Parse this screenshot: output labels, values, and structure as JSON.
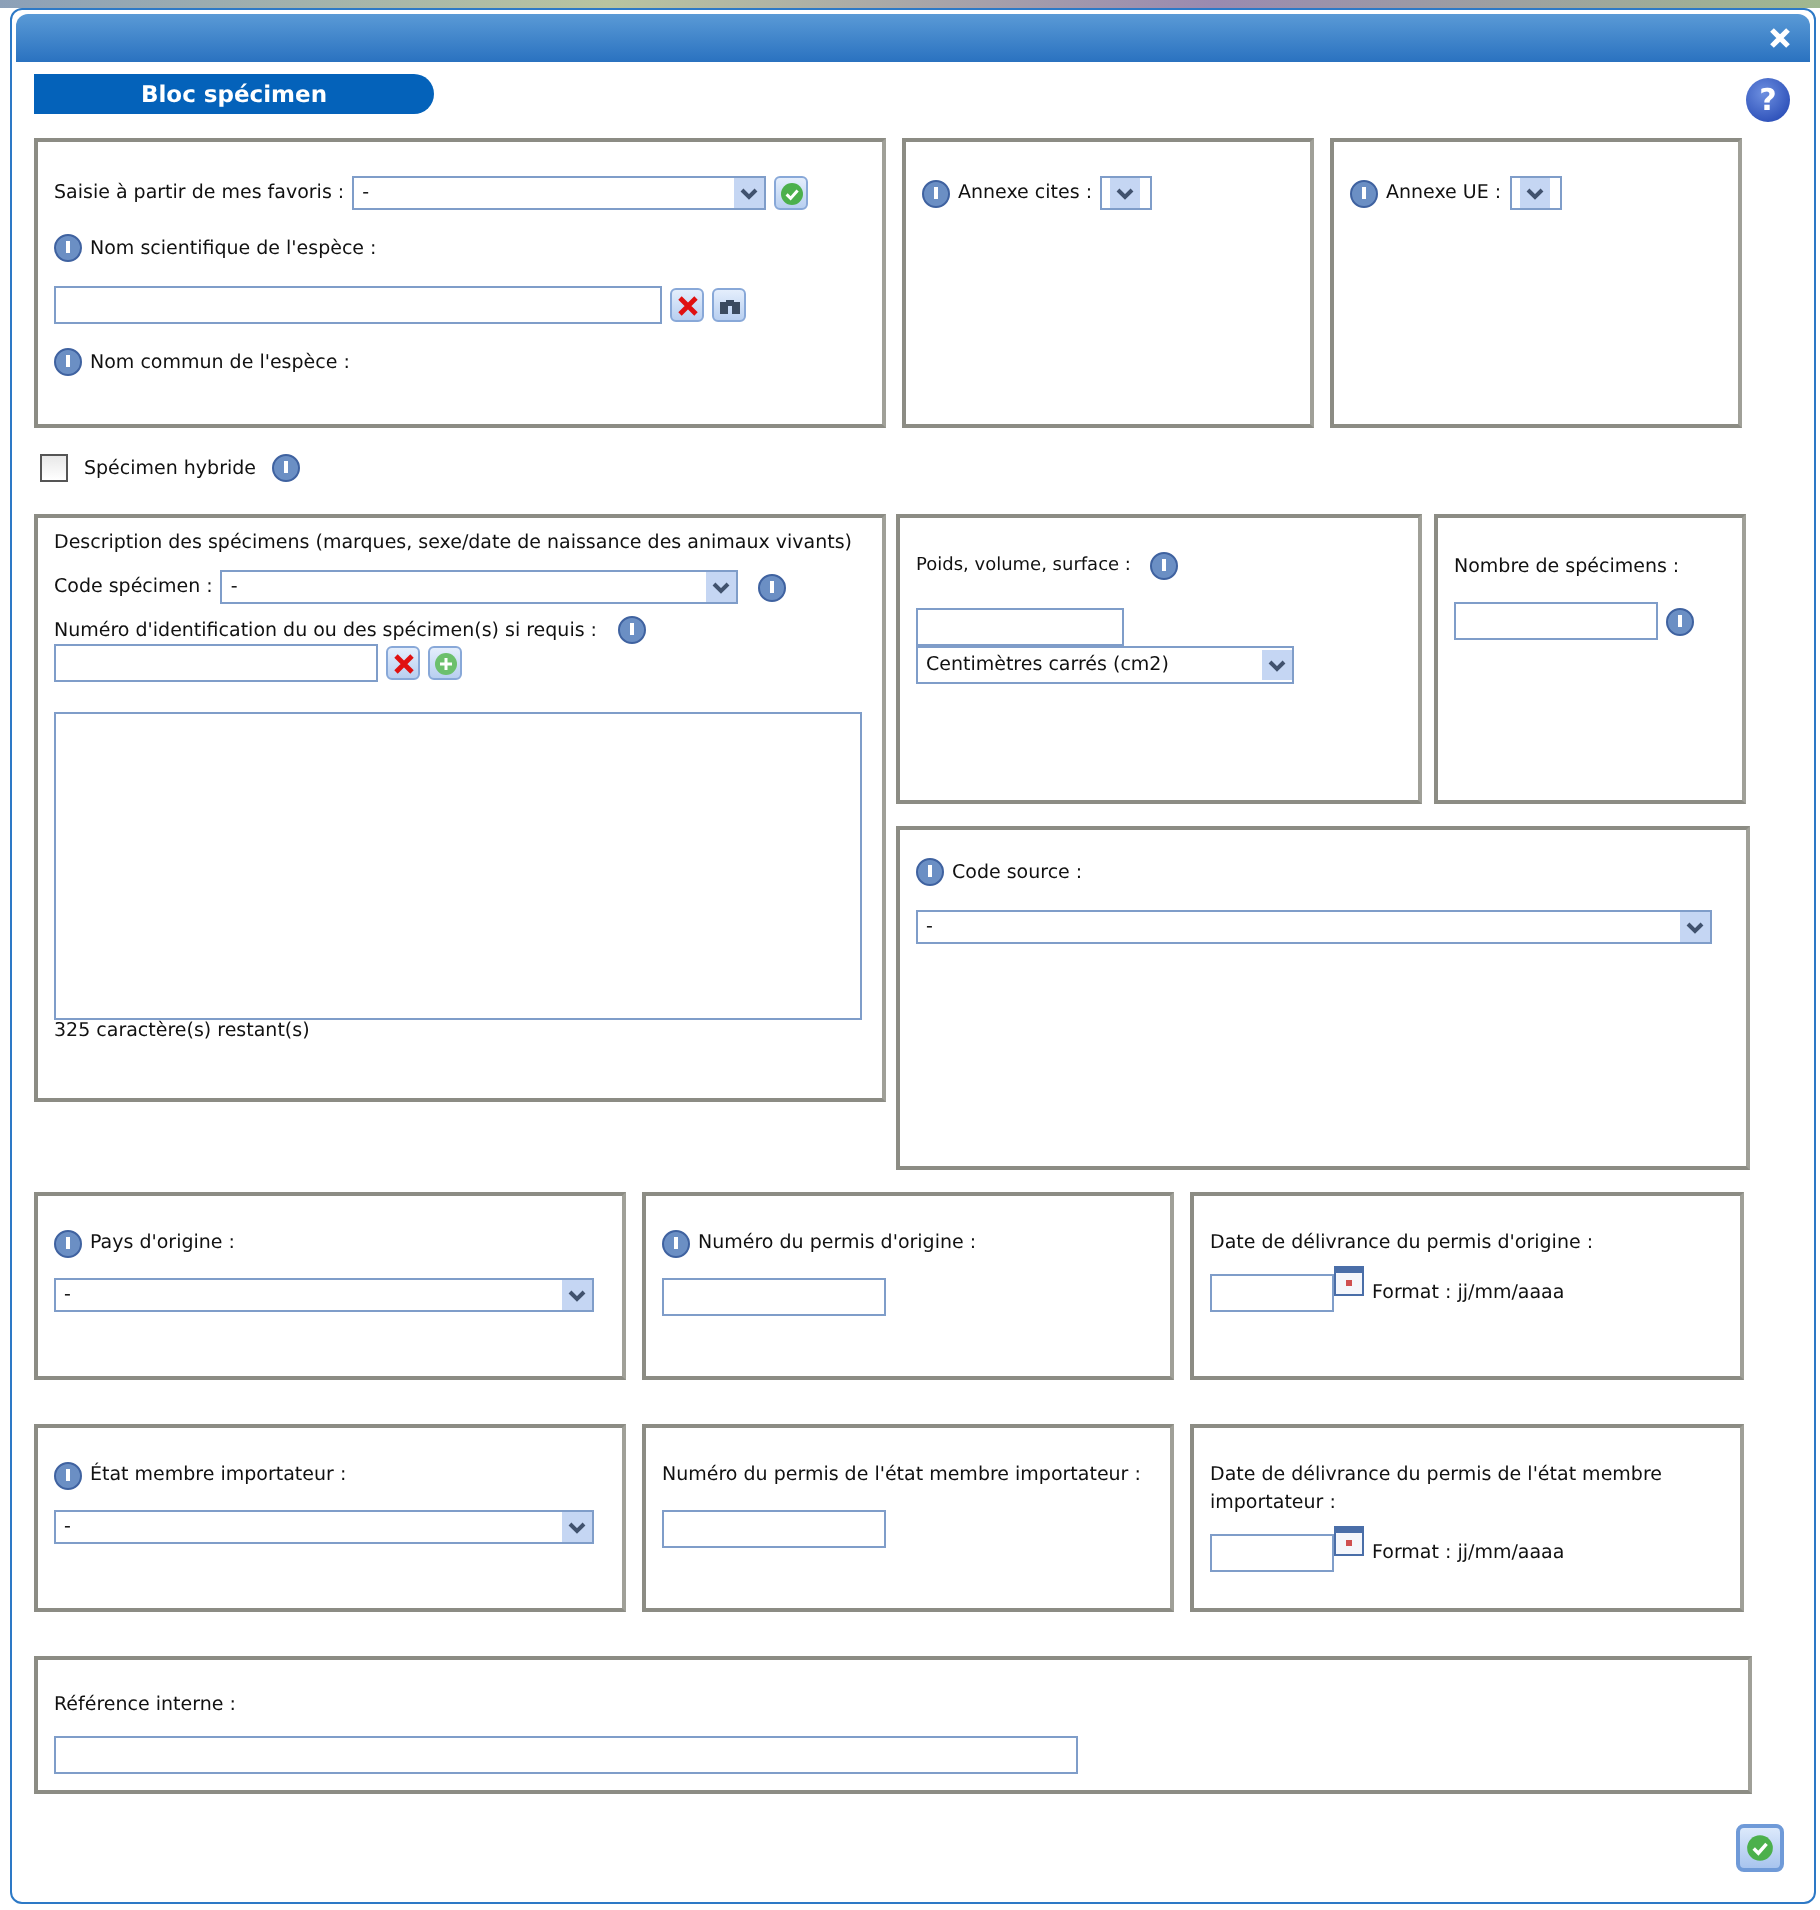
{
  "dialog": {
    "section_title": "Bloc spécimen",
    "help": "?"
  },
  "favorites": {
    "label": "Saisie à partir de mes favoris :",
    "value": "-"
  },
  "scientific_name": {
    "label": "Nom scientifique de l'espèce :"
  },
  "common_name": {
    "label": "Nom commun de l'espèce :"
  },
  "annex_cites": {
    "label": "Annexe cites :"
  },
  "annex_ue": {
    "label": "Annexe UE :"
  },
  "hybrid": {
    "label": "Spécimen hybride",
    "checked": false
  },
  "description": {
    "label": "Description des spécimens (marques, sexe/date de naissance des animaux vivants)",
    "code_label": "Code spécimen :",
    "code_value": "-",
    "id_label": "Numéro d'identification du ou des spécimen(s) si requis :",
    "remaining": "325 caractère(s) restant(s)"
  },
  "measure": {
    "label": "Poids, volume, surface  :",
    "unit": "Centimètres carrés (cm2)"
  },
  "count": {
    "label": "Nombre de spécimens :"
  },
  "source": {
    "label": "Code source :",
    "value": "-"
  },
  "permit_rows": [
    [
      {
        "kind": "select",
        "label": "Pays d'origine :",
        "info": true,
        "value": "-"
      },
      {
        "kind": "text",
        "label": "Numéro du permis d'origine :",
        "info": true
      },
      {
        "kind": "date",
        "label": "Date de délivrance du permis d'origine :",
        "info": false,
        "format": "Format : jj/mm/aaaa"
      }
    ],
    [
      {
        "kind": "select",
        "label": "État membre importateur :",
        "info": true,
        "value": "-"
      },
      {
        "kind": "text",
        "label": "Numéro du permis de l'état membre importateur :",
        "info": false
      },
      {
        "kind": "date",
        "label": "Date de délivrance du permis de l'état membre importateur :",
        "info": false,
        "format": "Format : jj/mm/aaaa"
      }
    ]
  ],
  "internal_reference": {
    "label": "Référence interne :"
  }
}
